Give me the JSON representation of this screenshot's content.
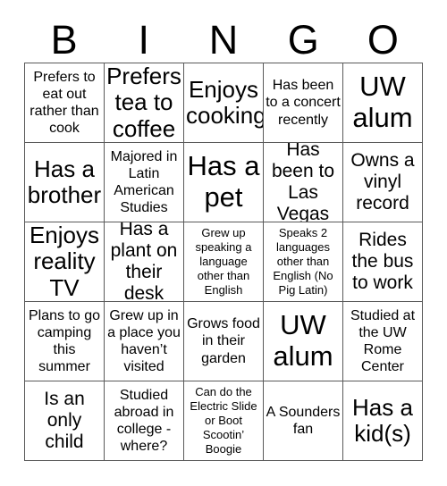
{
  "card": {
    "title": "BINGO",
    "header_letters": [
      "B",
      "I",
      "N",
      "G",
      "O"
    ],
    "rows": [
      [
        {
          "text": "Prefers to eat out rather than cook",
          "size": "sm"
        },
        {
          "text": "Prefers tea to coffee",
          "size": "lg"
        },
        {
          "text": "Enjoys cooking",
          "size": "lg"
        },
        {
          "text": "Has been to a concert recently",
          "size": "sm"
        },
        {
          "text": "UW alum",
          "size": "xl"
        }
      ],
      [
        {
          "text": "Has a brother",
          "size": "lg"
        },
        {
          "text": "Majored in Latin American Studies",
          "size": "sm"
        },
        {
          "text": "Has a pet",
          "size": "xl"
        },
        {
          "text": "Has been to Las Vegas",
          "size": "md"
        },
        {
          "text": "Owns a vinyl record",
          "size": "md"
        }
      ],
      [
        {
          "text": "Enjoys reality TV",
          "size": "lg"
        },
        {
          "text": "Has a plant on their desk",
          "size": "md"
        },
        {
          "text": "Grew up speaking a language other than English",
          "size": "xs"
        },
        {
          "text": "Speaks 2 languages other than English (No Pig Latin)",
          "size": "xs"
        },
        {
          "text": "Rides the bus to work",
          "size": "md"
        }
      ],
      [
        {
          "text": "Plans to go camping this summer",
          "size": "sm"
        },
        {
          "text": "Grew up in a place you haven’t visited",
          "size": "sm"
        },
        {
          "text": "Grows food in their garden",
          "size": "sm"
        },
        {
          "text": "UW alum",
          "size": "xl"
        },
        {
          "text": "Studied at the UW Rome Center",
          "size": "sm"
        }
      ],
      [
        {
          "text": "Is an only child",
          "size": "md"
        },
        {
          "text": "Studied abroad in college - where?",
          "size": "sm"
        },
        {
          "text": "Can do the Electric Slide or Boot Scootin’ Boogie",
          "size": "xs"
        },
        {
          "text": "A Sounders fan",
          "size": "sm"
        },
        {
          "text": "Has a kid(s)",
          "size": "lg"
        }
      ]
    ],
    "colors": {
      "background": "#ffffff",
      "text": "#000000",
      "grid_line": "#5a5a5a"
    }
  }
}
